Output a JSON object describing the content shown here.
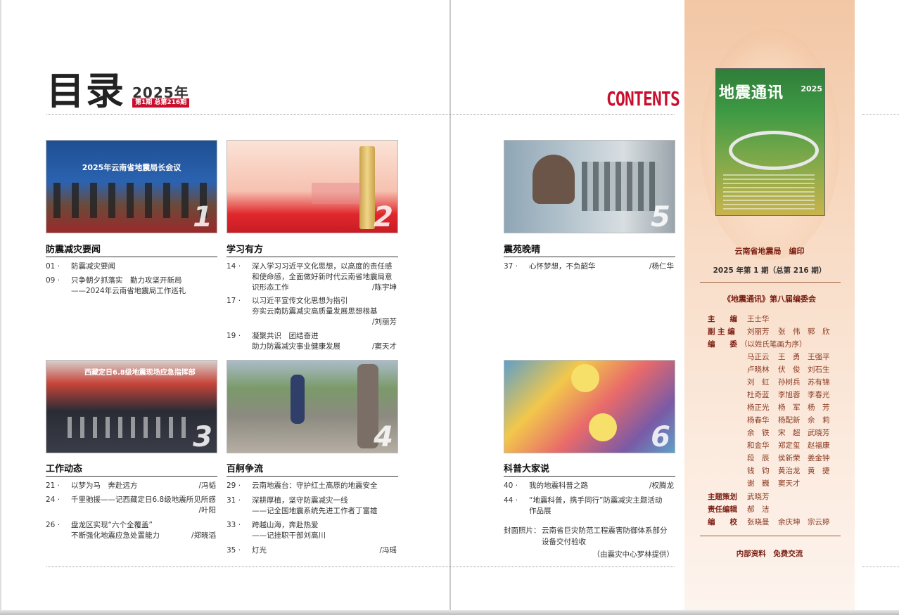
{
  "header": {
    "title": "目录",
    "year": "2025年",
    "issue": "第1期 总第216期",
    "contents": "CONTENTS"
  },
  "sections": [
    {
      "title": "防震减灾要闻",
      "photo_num": "1",
      "photo_caption": "2025年云南省地震局长会议",
      "items": [
        {
          "page": "01 ·",
          "lines": [
            "防震减灾要闻"
          ],
          "author": ""
        },
        {
          "page": "09 ·",
          "lines": [
            "只争朝夕抓落实　勤力攻坚开新局",
            "——2024年云南省地震局工作巡礼"
          ],
          "author": ""
        }
      ]
    },
    {
      "title": "学习有方",
      "photo_num": "2",
      "items": [
        {
          "page": "14 ·",
          "lines": [
            "深入学习习近平文化思想，以高度的责任感",
            "和使命感，全面做好新时代云南省地震局意",
            "识形态工作"
          ],
          "author": "/陈宇坤"
        },
        {
          "page": "17 ·",
          "lines": [
            "以习近平宣传文化思想为指引",
            "夯实云南防震减灾高质量发展思想根基"
          ],
          "author": "/刘丽芳"
        },
        {
          "page": "19 ·",
          "lines": [
            "凝聚共识　团结奋进",
            "助力防震减灾事业健康发展"
          ],
          "author": "/窦天才"
        }
      ]
    },
    {
      "title": "震苑晚晴",
      "photo_num": "5",
      "items": [
        {
          "page": "37 ·",
          "lines": [
            "心怀梦想，不负韶华"
          ],
          "author": "/杨仁华"
        }
      ]
    },
    {
      "title": "工作动态",
      "photo_num": "3",
      "photo_caption": "西藏定日6.8级地震现场应急指挥部",
      "items": [
        {
          "page": "21 ·",
          "lines": [
            "以梦为马　奔赴远方"
          ],
          "author": "/冯韬"
        },
        {
          "page": "24 ·",
          "lines": [
            "千里驰援——记西藏定日6.8级地震所见所感"
          ],
          "author": "/叶阳"
        },
        {
          "page": "26 ·",
          "lines": [
            "盘龙区实现“六个全覆盖”",
            "不断强化地震应急处置能力"
          ],
          "author": "/郑晓滔"
        }
      ]
    },
    {
      "title": "百舸争流",
      "photo_num": "4",
      "items": [
        {
          "page": "29 ·",
          "lines": [
            "云南地震台：守护红土高原的地震安全"
          ],
          "author": ""
        },
        {
          "page": "31 ·",
          "lines": [
            "深耕厚植，坚守防震减灾一线",
            "——记全国地震系统先进工作者丁富雄"
          ],
          "author": ""
        },
        {
          "page": "33 ·",
          "lines": [
            "跨越山海，奔赴热爱",
            "——记挂职干部刘高川"
          ],
          "author": ""
        },
        {
          "page": "35 ·",
          "lines": [
            "灯光"
          ],
          "author": "/冯瑶"
        }
      ]
    },
    {
      "title": "科普大家说",
      "photo_num": "6",
      "items": [
        {
          "page": "40 ·",
          "lines": [
            "我的地震科普之路"
          ],
          "author": "/权腾龙"
        },
        {
          "page": "44 ·",
          "lines": [
            "“地震科普，携手同行”防震减灾主题活动",
            "作品展"
          ],
          "author": ""
        }
      ]
    }
  ],
  "cover_note": {
    "label": "封面照片：",
    "line1": "云南省巨灾防范工程震害防御体系部分",
    "line2": "设备交付验收",
    "credit": "（由震灾中心罗林提供）"
  },
  "panel": {
    "cover_title": "地震通讯",
    "cover_year": "2025",
    "publisher": "云南省地震局　编印",
    "issue_line": "2025 年第 1 期（总第 216 期）",
    "board_title": "《地震通讯》第八届编委会",
    "roles": [
      {
        "role": "主　　编",
        "names": [
          "王士华"
        ]
      },
      {
        "role": "副 主 编",
        "names": [
          "刘丽芳",
          "张　伟",
          "郭　欣"
        ]
      },
      {
        "role": "编　　委",
        "names": [
          "（以姓氏笔画为序）"
        ]
      }
    ],
    "members": [
      [
        "马正云",
        "王　勇",
        "王强平"
      ],
      [
        "卢晓林",
        "伏　俊",
        "刘石生"
      ],
      [
        "刘　虹",
        "孙树兵",
        "苏有锦"
      ],
      [
        "杜奇蓝",
        "李旭蓉",
        "李春光"
      ],
      [
        "杨正光",
        "杨　军",
        "杨　芳"
      ],
      [
        "杨春华",
        "杨配新",
        "佘　莉"
      ],
      [
        "余　铁",
        "宋　超",
        "武晓芳"
      ],
      [
        "和金华",
        "郑定玺",
        "赵福康"
      ],
      [
        "段　辰",
        "侯新荣",
        "姜金钟"
      ],
      [
        "钱　钧",
        "黄治龙",
        "黄　捷"
      ],
      [
        "谢　巍",
        "窦天才",
        ""
      ]
    ],
    "extra_roles": [
      {
        "role": "主题策划",
        "names": [
          "武晓芳"
        ]
      },
      {
        "role": "责任编辑",
        "names": [
          "郝　洁"
        ]
      },
      {
        "role": "编　　校",
        "names": [
          "张晓曼",
          "余庆坤",
          "宗云婷"
        ]
      }
    ],
    "footer": "内部资料　免费交流"
  }
}
